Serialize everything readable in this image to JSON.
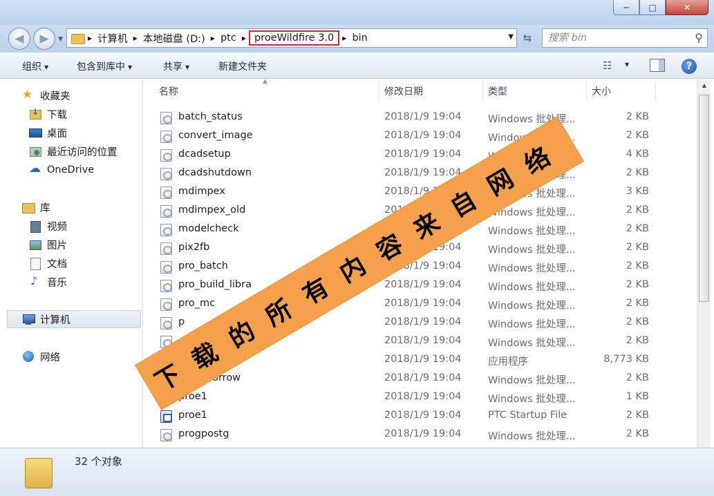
{
  "window": {
    "controls": {
      "minimize": "─",
      "maximize": "□",
      "close": "✕"
    }
  },
  "address": {
    "crumbs": [
      "计算机",
      "本地磁盘 (D:)",
      "ptc",
      "proeWildfire 3.0",
      "bin"
    ],
    "highlighted_crumb": "proeWildfire 3.0"
  },
  "search": {
    "placeholder": "搜索 bin"
  },
  "toolbar": {
    "organize": "组织",
    "include_in_library": "包含到库中",
    "share": "共享",
    "new_folder": "新建文件夹"
  },
  "sidebar": {
    "favorites": "收藏夹",
    "favorites_items": [
      "下载",
      "桌面",
      "最近访问的位置"
    ],
    "onedrive": "OneDrive",
    "libraries": "库",
    "library_items": [
      "视频",
      "图片",
      "文档",
      "音乐"
    ],
    "computer": "计算机",
    "network": "网络"
  },
  "columns": {
    "name": "名称",
    "date": "修改日期",
    "type": "类型",
    "size": "大小"
  },
  "files": [
    {
      "name": "batch_status",
      "date": "2018/1/9 19:04",
      "type": "Windows 批处理...",
      "size": "2 KB",
      "icon": "batch-file-icon"
    },
    {
      "name": "convert_image",
      "date": "2018/1/9 19:04",
      "type": "Windows 批处理...",
      "size": "2 KB",
      "icon": "batch-file-icon"
    },
    {
      "name": "dcadsetup",
      "date": "2018/1/9 19:04",
      "type": "Windows 批处理...",
      "size": "4 KB",
      "icon": "batch-file-icon"
    },
    {
      "name": "dcadshutdown",
      "date": "2018/1/9 19:04",
      "type": "Windows 批处理...",
      "size": "2 KB",
      "icon": "batch-file-icon"
    },
    {
      "name": "mdimpex",
      "date": "2018/1/9 19:04",
      "type": "Windows 批处理...",
      "size": "3 KB",
      "icon": "batch-file-icon"
    },
    {
      "name": "mdimpex_old",
      "date": "2018/1/9 19:04",
      "type": "Windows 批处理...",
      "size": "2 KB",
      "icon": "batch-file-icon"
    },
    {
      "name": "modelcheck",
      "date": "2018/1/9 19:04",
      "type": "Windows 批处理...",
      "size": "2 KB",
      "icon": "batch-file-icon"
    },
    {
      "name": "pix2fb",
      "date": "2018/1/9 19:04",
      "type": "Windows 批处理...",
      "size": "2 KB",
      "icon": "batch-file-icon"
    },
    {
      "name": "pro_batch",
      "date": "2018/1/9 19:04",
      "type": "Windows 批处理...",
      "size": "2 KB",
      "icon": "batch-file-icon"
    },
    {
      "name": "pro_build_libra",
      "date": "2018/1/9 19:04",
      "type": "Windows 批处理...",
      "size": "2 KB",
      "icon": "batch-file-icon"
    },
    {
      "name": "pro_mc",
      "date": "2018/1/9 19:04",
      "type": "Windows 批处理...",
      "size": "2 KB",
      "icon": "batch-file-icon"
    },
    {
      "name": "p",
      "date": "2018/1/9 19:04",
      "type": "Windows 批处理...",
      "size": "2 KB",
      "icon": "batch-file-icon"
    },
    {
      "name": "",
      "date": "2018/1/9 19:04",
      "type": "Windows 批处理...",
      "size": "2 KB",
      "icon": "batch-file-icon"
    },
    {
      "name": "",
      "date": "2018/1/9 19:04",
      "type": "应用程序",
      "size": "8,773 KB",
      "icon": "application-icon"
    },
    {
      "name": "proe_borrow",
      "date": "2018/1/9 19:04",
      "type": "Windows 批处理...",
      "size": "2 KB",
      "icon": "batch-file-icon"
    },
    {
      "name": "proe1",
      "date": "2018/1/9 19:04",
      "type": "Windows 批处理...",
      "size": "1 KB",
      "icon": "batch-file-icon"
    },
    {
      "name": "proe1",
      "date": "2018/1/9 19:04",
      "type": "PTC Startup File",
      "size": "2 KB",
      "icon": "ptc-startup-file-icon"
    },
    {
      "name": "progpostg",
      "date": "2018/1/9 19:04",
      "type": "Windows 批处理...",
      "size": "2 KB",
      "icon": "batch-file-icon"
    }
  ],
  "status": {
    "count_text": "32 个对象"
  },
  "watermark": {
    "text": "下载的所有内容来自网络",
    "color": "#f5a04a"
  },
  "colors": {
    "highlight_border": "#e0202a",
    "chrome": "#c9dcf1"
  }
}
